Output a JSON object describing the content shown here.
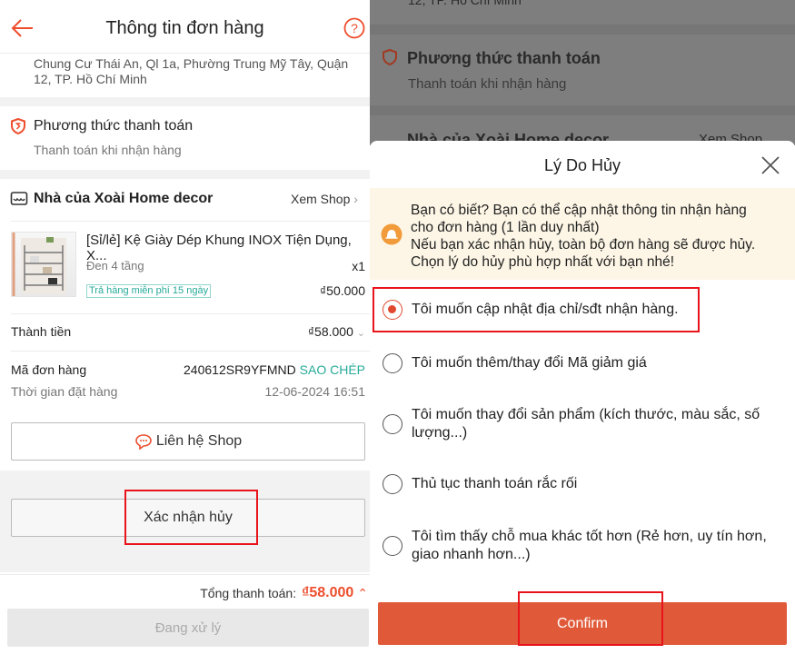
{
  "left": {
    "header": {
      "title": "Thông tin đơn hàng",
      "back_icon": "arrow-left-icon",
      "help_icon": "question-circle-icon"
    },
    "address": {
      "line1": "Chung Cư Thái An, Ql 1a, Phường Trung Mỹ Tây, Quận",
      "line2": "12, TP. Hồ Chí Minh"
    },
    "payment": {
      "title": "Phương thức thanh toán",
      "value": "Thanh toán khi nhận hàng"
    },
    "shop": {
      "name": "Nhà của Xoài Home decor",
      "view_shop": "Xem Shop"
    },
    "product": {
      "name": "[Sỉ/lẻ] Kệ Giày Dép Khung INOX Tiện Dụng, X...",
      "variant": "Đen 4 tầng",
      "qty": "x1",
      "badge": "Trả hàng miễn phí 15 ngày",
      "price": "₫50.000"
    },
    "total": {
      "label": "Thành tiền",
      "value": "₫58.000"
    },
    "order": {
      "id_label": "Mã đơn hàng",
      "id": "240612SR9YFMND",
      "copy": "SAO CHÉP",
      "time_label": "Thời gian đặt hàng",
      "time": "12-06-2024 16:51"
    },
    "contact_button": "Liên hệ Shop",
    "confirm_cancel_button": "Xác nhận hủy",
    "footer": {
      "total_label": "Tổng thanh toán:",
      "total_value": "₫58.000",
      "status_button": "Đang xử lý"
    }
  },
  "right": {
    "background": {
      "address_tail": "12, TP. Hồ Chí Minh",
      "payment_title": "Phương thức thanh toán",
      "payment_value": "Thanh toán khi nhận hàng",
      "shop_name": "Nhà của Xoài Home decor",
      "view_shop": "Xem Shop"
    },
    "modal": {
      "title": "Lý Do Hủy",
      "info": [
        "Bạn có biết? Bạn có thể cập nhật thông tin nhận hàng",
        "cho đơn hàng (1 lần duy nhất)",
        "Nếu bạn xác nhận hủy, toàn bộ đơn hàng sẽ được hủy.",
        "Chọn lý do hủy phù hợp nhất với bạn nhé!"
      ],
      "options": [
        {
          "label": "Tôi muốn cập nhật địa chỉ/sđt nhận hàng.",
          "selected": true
        },
        {
          "label": "Tôi muốn thêm/thay đổi Mã giảm giá",
          "selected": false
        },
        {
          "label": "Tôi muốn thay đổi sản phẩm (kích thước, màu sắc, số lượng...)",
          "selected": false
        },
        {
          "label": "Thủ tục thanh toán rắc rối",
          "selected": false
        },
        {
          "label": "Tôi tìm thấy chỗ mua khác tốt hơn (Rẻ hơn, uy tín hơn, giao nhanh hơn...)",
          "selected": false
        }
      ],
      "confirm_button": "Confirm"
    }
  },
  "colors": {
    "accent": "#ee4d2d",
    "confirm": "#e05a3a",
    "copy": "#26aa99",
    "highlight": "#e8131b"
  }
}
